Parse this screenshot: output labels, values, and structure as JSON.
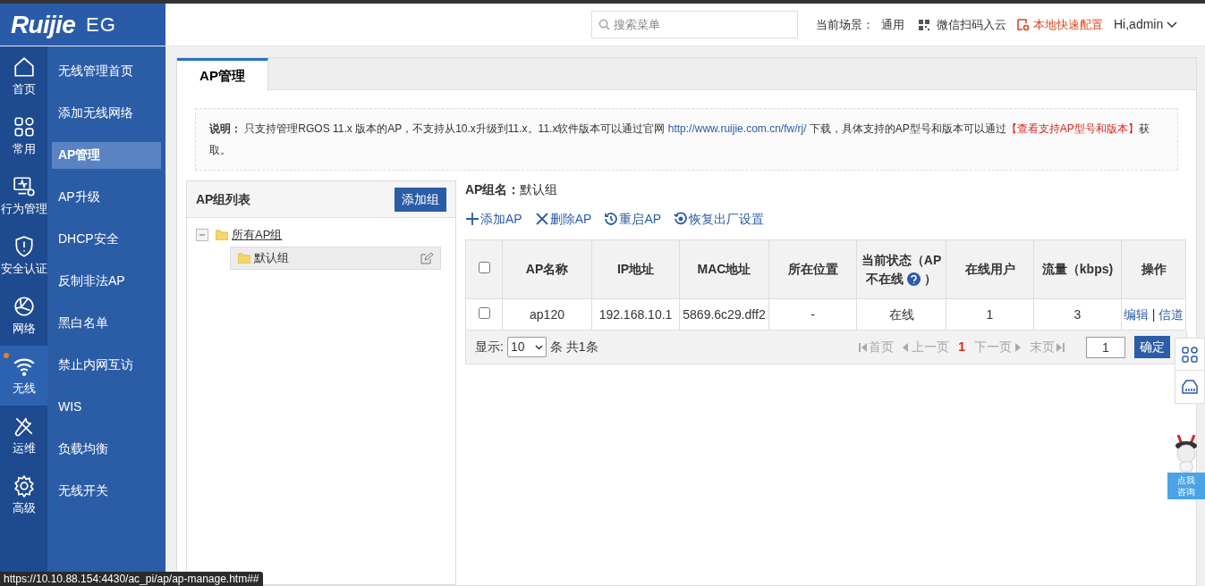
{
  "logo": {
    "brand": "Ruijie",
    "product": "EG"
  },
  "header": {
    "search_placeholder": "搜索菜单",
    "scene_label": "当前场景：",
    "scene": "通用",
    "wechat": "微信扫码入云",
    "quick_config": "本地快速配置",
    "user": "Hi,admin"
  },
  "nav": [
    {
      "label": "首页",
      "kind": "home",
      "selected": false,
      "dot": false
    },
    {
      "label": "常用",
      "kind": "apps",
      "selected": false,
      "dot": false
    },
    {
      "label": "行为管理",
      "kind": "monitor",
      "selected": false,
      "dot": false
    },
    {
      "label": "安全认证",
      "kind": "shield",
      "selected": false,
      "dot": false
    },
    {
      "label": "网络",
      "kind": "globe",
      "selected": false,
      "dot": false
    },
    {
      "label": "无线",
      "kind": "wifi",
      "selected": true,
      "dot": true
    },
    {
      "label": "运维",
      "kind": "tools",
      "selected": false,
      "dot": false
    },
    {
      "label": "高级",
      "kind": "gear",
      "selected": false,
      "dot": false
    }
  ],
  "sub_menu": [
    {
      "label": "无线管理首页",
      "selected": false
    },
    {
      "label": "添加无线网络",
      "selected": false
    },
    {
      "label": "AP管理",
      "selected": true
    },
    {
      "label": "AP升级",
      "selected": false
    },
    {
      "label": "DHCP安全",
      "selected": false
    },
    {
      "label": "反制非法AP",
      "selected": false
    },
    {
      "label": "黑白名单",
      "selected": false
    },
    {
      "label": "禁止内网互访",
      "selected": false
    },
    {
      "label": "WIS",
      "selected": false
    },
    {
      "label": "负载均衡",
      "selected": false
    },
    {
      "label": "无线开关",
      "selected": false
    }
  ],
  "tabs": [
    {
      "label": "AP管理",
      "selected": true
    }
  ],
  "notice": {
    "label": "说明：",
    "before": "只支持管理RGOS 11.x 版本的AP，不支持从10.x升级到11.x。11.x软件版本可以通过官网",
    "url": "http://www.ruijie.com.cn/fw/rj/",
    "middle": "下载，具体支持的AP型号和版本可以通过",
    "link": "【查看支持AP型号和版本】",
    "after": "获取。"
  },
  "group_panel": {
    "title": "AP组列表",
    "add_button": "添加组",
    "tree": [
      {
        "label": "所有AP组",
        "expanded": true,
        "selected": false,
        "children": [
          {
            "label": "默认组",
            "selected": true
          }
        ]
      }
    ]
  },
  "group_name": {
    "label": "AP组名：",
    "value": "默认组"
  },
  "actions": [
    {
      "label": "添加AP",
      "kind": "plus"
    },
    {
      "label": "删除AP",
      "kind": "x"
    },
    {
      "label": "重启AP",
      "kind": "restart"
    },
    {
      "label": "恢复出厂设置",
      "kind": "reset"
    }
  ],
  "table": {
    "columns": [
      {
        "label": "AP名称"
      },
      {
        "label": "IP地址"
      },
      {
        "label": "MAC地址"
      },
      {
        "label": "所在位置"
      },
      {
        "label": "当前状态（AP不在线",
        "suffix": "）",
        "help": true
      },
      {
        "label": "在线用户"
      },
      {
        "label": "流量（kbps)"
      },
      {
        "label": "操作"
      }
    ],
    "all_checked": false,
    "rows": [
      {
        "checked": false,
        "cells": [
          "ap120",
          "192.168.10.1",
          "5869.6c29.dff2",
          "-",
          "在线",
          "1",
          "3"
        ],
        "ops": [
          "编辑",
          "信道"
        ],
        "ops_separator": "|"
      }
    ]
  },
  "pagination": {
    "show_label": "显示:",
    "page_size": "10",
    "count": "条 共1条",
    "first": "首页",
    "prev": "上一页",
    "current": "1",
    "next": "下一页",
    "last": "末页",
    "page_input": "1",
    "confirm": "确定"
  },
  "mascot": {
    "caption": [
      "点我",
      "咨询"
    ]
  },
  "status_url": "https://10.10.88.154:4430/ac_pi/ap/ap-manage.htm##"
}
